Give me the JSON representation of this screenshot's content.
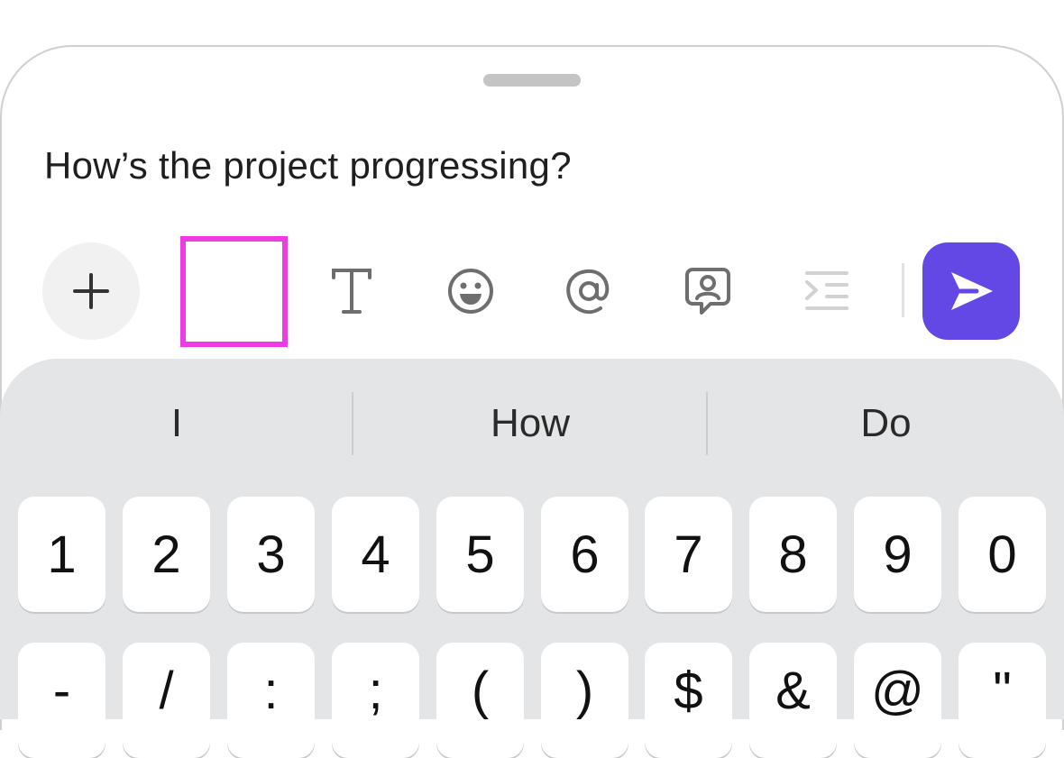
{
  "composer": {
    "message": "How’s the project progressing?"
  },
  "toolbar": {
    "plus_icon": "plus-icon",
    "voice_icon": "voice-waveform-icon",
    "text_icon": "text-format-icon",
    "emoji_icon": "smiley-face-icon",
    "mention_icon": "at-sign-icon",
    "contact_icon": "contact-card-icon",
    "indent_icon": "indent-icon",
    "send_icon": "send-arrow-icon",
    "send_color": "#6448e6",
    "highlight_color": "#ee3be4"
  },
  "suggestions": [
    "I",
    "How",
    "Do"
  ],
  "keyboard": {
    "number_row": [
      "1",
      "2",
      "3",
      "4",
      "5",
      "6",
      "7",
      "8",
      "9",
      "0"
    ],
    "symbol_row": [
      "-",
      "/",
      ":",
      ";",
      "(",
      ")",
      "$",
      "&",
      "@",
      "\""
    ]
  }
}
